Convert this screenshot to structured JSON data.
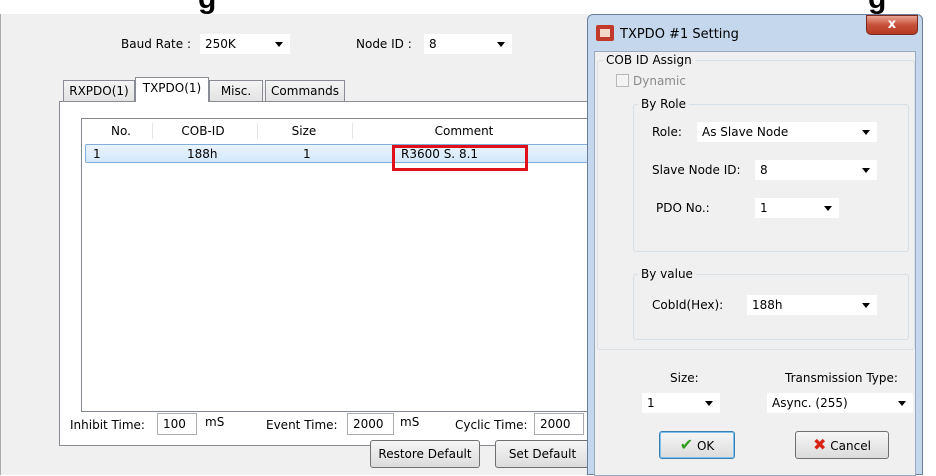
{
  "main": {
    "baud_rate_label": "Baud Rate :",
    "baud_rate_value": "250K",
    "node_id_label": "Node ID :",
    "node_id_value": "8",
    "tabs": [
      {
        "label": "RXPDO(1)"
      },
      {
        "label": "TXPDO(1)"
      },
      {
        "label": "Misc."
      },
      {
        "label": "Commands"
      }
    ],
    "table": {
      "columns": [
        "No.",
        "COB-ID",
        "Size",
        "Comment"
      ],
      "rows": [
        {
          "no": "1",
          "cob_id": "188h",
          "size": "1",
          "comment": "R3600 S. 8.1"
        }
      ]
    },
    "inhibit_time_label": "Inhibit Time:",
    "inhibit_time_value": "100",
    "inhibit_time_unit": "mS",
    "event_time_label": "Event Time:",
    "event_time_value": "2000",
    "event_time_unit": "mS",
    "cyclic_time_label": "Cyclic Time:",
    "cyclic_time_value": "2000",
    "restore_default_label": "Restore Default",
    "set_default_label": "Set Default"
  },
  "dialog": {
    "title": "TXPDO #1 Setting",
    "close_label": "x",
    "cob_id_assign_label": "COB ID Assign",
    "dynamic_label": "Dynamic",
    "dynamic_checked": false,
    "by_role_label": "By Role",
    "role_label": "Role:",
    "role_value": "As Slave Node",
    "slave_node_id_label": "Slave Node ID:",
    "slave_node_id_value": "8",
    "pdo_no_label": "PDO No.:",
    "pdo_no_value": "1",
    "by_value_label": "By value",
    "cobid_hex_label": "CobId(Hex):",
    "cobid_hex_value": "188h",
    "size_label": "Size:",
    "size_value": "1",
    "transmission_type_label": "Transmission Type:",
    "transmission_type_value": "Async. (255)",
    "ok_label": "OK",
    "cancel_label": "Cancel"
  },
  "colors": {
    "highlight_box": "#e0101a",
    "ok_check": "#2f9e1f",
    "cancel_x": "#d9241a",
    "dialog_frame": "#c5d7ec"
  },
  "icons": [
    "app-icon",
    "check-icon",
    "x-icon",
    "chevron-down-icon"
  ]
}
